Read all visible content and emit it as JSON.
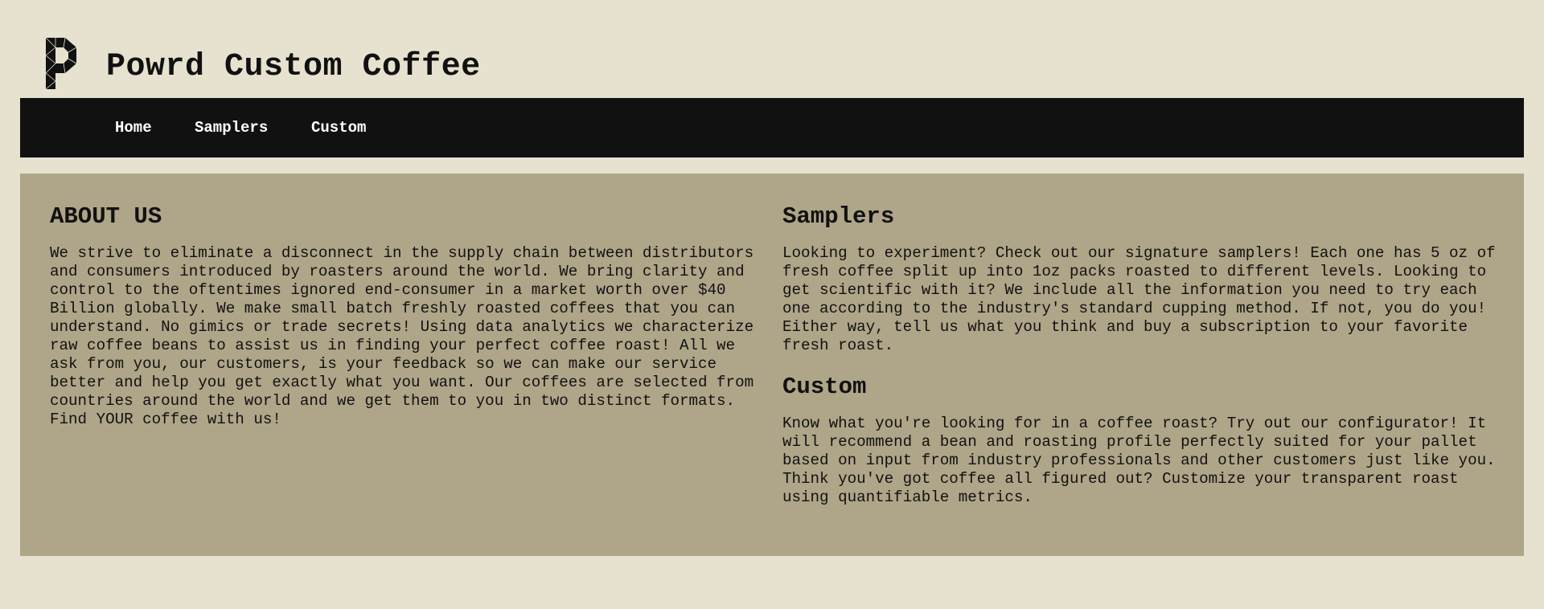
{
  "header": {
    "title": "Powrd Custom Coffee",
    "logo_icon": "powrd-p-logo-icon"
  },
  "nav": {
    "items": [
      {
        "label": "Home"
      },
      {
        "label": "Samplers"
      },
      {
        "label": "Custom"
      }
    ]
  },
  "about": {
    "title": "ABOUT US",
    "text": "We strive to eliminate a disconnect in the supply chain between distributors and consumers introduced by roasters around the world. We bring clarity and control to the oftentimes ignored end-consumer in a market worth over $40 Billion globally. We make small batch freshly roasted coffees that you can understand. No gimics or trade secrets! Using data analytics we characterize raw coffee beans to assist us in finding your perfect coffee roast! All we ask from you, our customers, is your feedback so we can make our service better and help you get exactly what you want. Our coffees are selected from countries around the world and we get them to you in two distinct formats. Find YOUR coffee with us!"
  },
  "samplers": {
    "title": "Samplers",
    "text": "Looking to experiment? Check out our signature samplers! Each one has 5 oz of fresh coffee split up into 1oz packs roasted to different levels. Looking to get scientific with it? We include all the information you need to try each one according to the industry's standard cupping method. If not, you do you! Either way, tell us what you think and buy a subscription to your favorite fresh roast."
  },
  "custom": {
    "title": "Custom",
    "text": "Know what you're looking for in a coffee roast? Try out our configurator! It will recommend a bean and roasting profile perfectly suited for your pallet based on input from industry professionals and other customers just like you. Think you've got coffee all figured out? Customize your transparent roast using quantifiable metrics."
  },
  "colors": {
    "page_background": "#e6e2cf",
    "navbar_background": "#111111",
    "content_background": "#afa588",
    "text": "#111111"
  }
}
